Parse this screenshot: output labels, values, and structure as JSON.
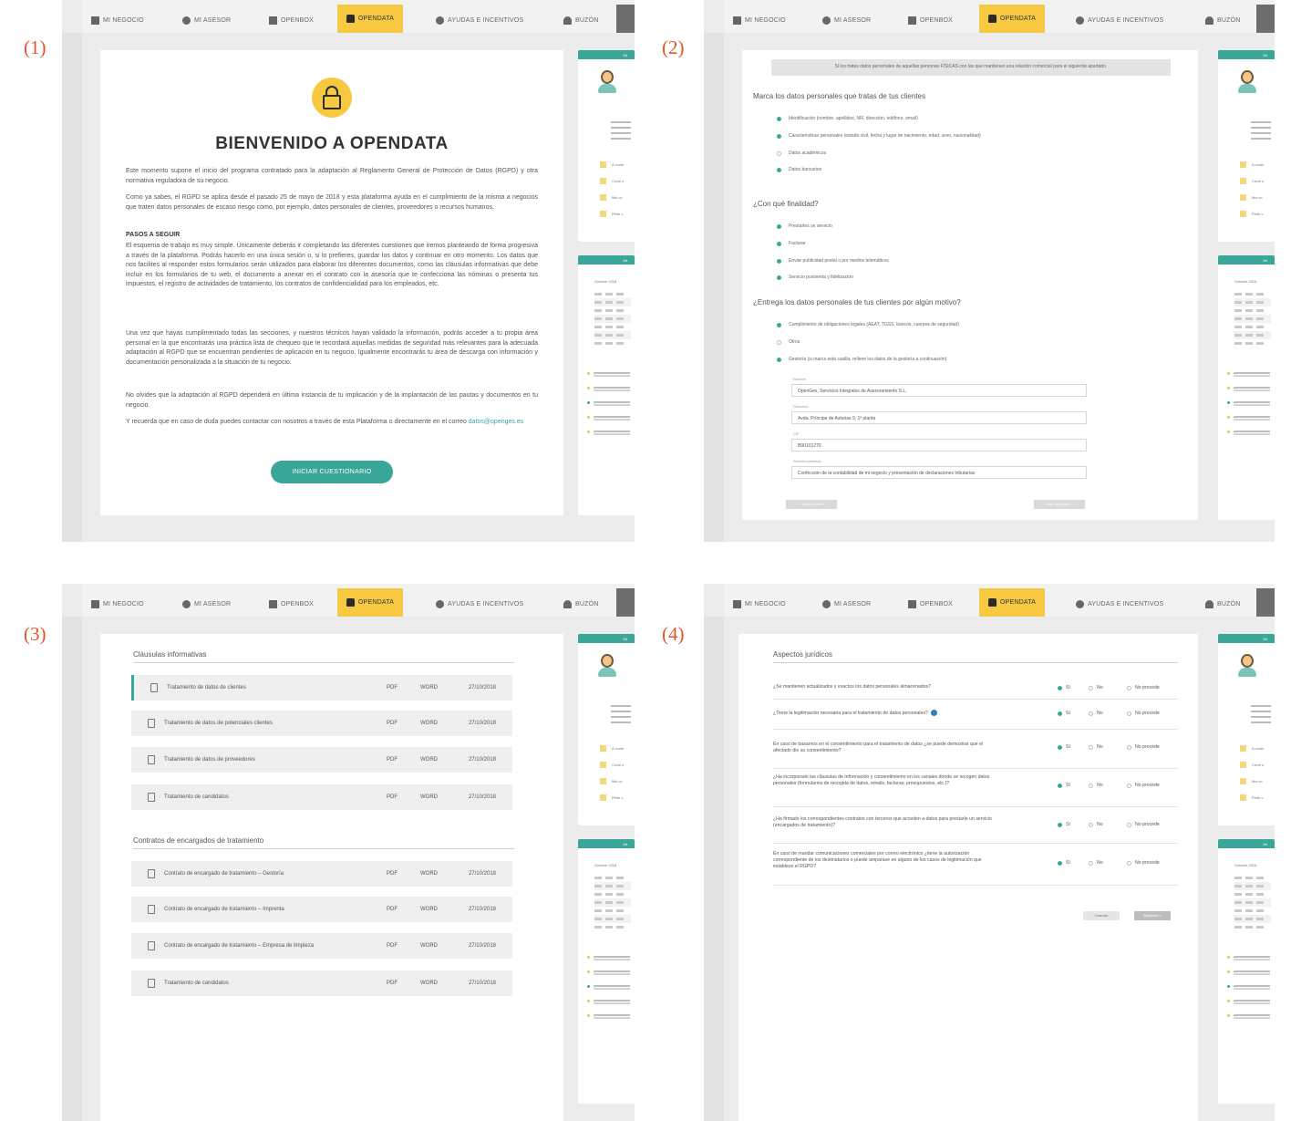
{
  "panel_labels": [
    "(1)",
    "(2)",
    "(3)",
    "(4)"
  ],
  "nav": {
    "mi_negocio": "MI NEGOCIO",
    "mi_asesor": "MI ASESOR",
    "openbox": "OPENBOX",
    "opendata": "OPENDATA",
    "ayudas": "AYUDAS E INCENTIVOS",
    "buzon": "BUZÓN"
  },
  "colors": {
    "accent": "#3aa69a",
    "highlight": "#f7c842",
    "label": "#e2552a"
  },
  "right_sidebar": {
    "card_header": "MI",
    "items": [
      "A conte",
      "Crear u",
      "Mis co",
      "Pedir c"
    ],
    "calendar_title": "Octubre 2018"
  },
  "welcome": {
    "title": "BIENVENIDO A OPENDATA",
    "p1": "Este momento supone el inicio del programa contratado para la adaptación al Reglamento General de Protección de Datos (RGPD) y otra normativa reguladora de su negocio.",
    "p2": "Como ya sabes, el RGPD se aplica desde el pasado 25 de mayo de 2018 y esta plataforma ayuda en el cumplimiento de la misma a negocios que traten datos personales de escaso riesgo como, por ejemplo, datos personales de clientes, proveedores o recursos humanos.",
    "steps_heading": "PASOS A SEGUIR",
    "p3": "El esquema de trabajo es muy simple. Únicamente deberás ir completando las diferentes cuestiones que iremos planteando de forma progresiva a través de la plataforma. Podrás hacerlo en una única sesión o, si lo prefieres, guardar los datos y continuar en otro momento. Los datos que nos facilites al responder estos formularios serán utilizados para elaborar los diferentes documentos, como las cláusulas informativas que debe incluir en los formularios de tu web, el documento a anexar en el contrato con la asesoría que te confecciona las nóminas o presenta tus impuestos, el registro de actividades de tratamiento, los contratos de confidencialidad para los empleados, etc.",
    "p4": "Una vez que hayas cumplimentado todas las secciones, y nuestros técnicos hayan validado la información, podrás acceder a tu propia área personal en la que encontrarás una práctica lista de chequeo que te recordará aquellas medidas de seguridad más relevantes para la adecuada adaptación al RGPD que se encuentran pendientes de aplicación en tu negocio. Igualmente encontrarás tu área de descarga con información y documentación personalizada a la situación de tu negocio.",
    "p5": "No olvides que la adaptación al RGPD dependerá en última instancia de tu implicación y de la implantación de las pautas y documentos en tu negocio.",
    "p6": "Y recuerda que en caso de duda puedes contactar con nosotros a través de esta Plataforma o directamente en el correo",
    "email": "datos@openges.es",
    "button": "INICIAR CUESTIONARIO"
  },
  "form": {
    "notice": "Si los tratas datos personales de aquellas personas FÍSICAS con las que mantienes una relación comercial para el siguiente apartado.",
    "q1": "Marca los datos personales que tratas de tus clientes",
    "q1_options": [
      {
        "label": "Identificación (nombre, apellidos, NIF, dirección, teléfono, email)",
        "checked": true
      },
      {
        "label": "Características personales (estado civil, fecha y lugar de nacimiento, edad, sexo, nacionalidad)",
        "checked": true
      },
      {
        "label": "Datos académicos",
        "checked": false
      },
      {
        "label": "Datos bancarios",
        "checked": true
      }
    ],
    "q2": "¿Con qué finalidad?",
    "q2_options": [
      {
        "label": "Prestarles un servicio",
        "checked": true
      },
      {
        "label": "Facturar",
        "checked": true
      },
      {
        "label": "Enviar publicidad postal o por medios telemáticos",
        "checked": true
      },
      {
        "label": "Servicio postventa y fidelización",
        "checked": true
      }
    ],
    "q3": "¿Entrega los datos personales de tus clientes por algún motivo?",
    "q3_options": [
      {
        "label": "Cumplimiento de obligaciones legales (AEAT, TGSS, bancos, cuerpos de seguridad)",
        "checked": true
      },
      {
        "label": "Otros",
        "checked": false
      },
      {
        "label": "Gestoría (si marca esta casilla, rellene los datos de la gestoría a continuación)",
        "checked": true
      }
    ],
    "fields": [
      {
        "label": "Nombre",
        "value": "OpenGes, Servicios Integrales de Asesoramiento S.L."
      },
      {
        "label": "Dirección",
        "value": "Avda. Príncipe de Asturias 9, 1ª planta"
      },
      {
        "label": "CIF",
        "value": "B90101270"
      },
      {
        "label": "Servicio prestado",
        "value": "Confección de la contabilidad de mi negocio y presentación de declaraciones tributarias"
      }
    ],
    "prev_button": "< Paso anterior",
    "next_button": "Paso siguiente >"
  },
  "docs": {
    "section1": "Cláusulas informativas",
    "rows1": [
      {
        "name": "Tratamiento de datos de clientes",
        "pdf": "PDF",
        "word": "WORD",
        "date": "27/10/2018"
      },
      {
        "name": "Tratamiento de datos de potenciales clientes",
        "pdf": "PDF",
        "word": "WORD",
        "date": "27/10/2018"
      },
      {
        "name": "Tratamiento de datos de proveedores",
        "pdf": "PDF",
        "word": "WORD",
        "date": "27/10/2018"
      },
      {
        "name": "Tratamiento de candidatos",
        "pdf": "PDF",
        "word": "WORD",
        "date": "27/10/2018"
      }
    ],
    "section2": "Contratos de encargados de tratamiento",
    "rows2": [
      {
        "name": "Contrato de encargado de tratamiento – Gestoría",
        "pdf": "PDF",
        "word": "WORD",
        "date": "27/10/2018"
      },
      {
        "name": "Contrato de encargado de tratamiento – Imprenta",
        "pdf": "PDF",
        "word": "WORD",
        "date": "27/10/2018"
      },
      {
        "name": "Contrato de encargado de tratamiento – Empresa de limpieza",
        "pdf": "PDF",
        "word": "WORD",
        "date": "27/10/2018"
      },
      {
        "name": "Tratamiento de candidatos",
        "pdf": "PDF",
        "word": "WORD",
        "date": "27/10/2018"
      }
    ]
  },
  "legal": {
    "title": "Aspectos jurídicos",
    "answers": {
      "si": "Sí",
      "no": "No",
      "np": "No procede"
    },
    "questions": [
      "¿Se mantienen actualizados y exactos los datos personales almacenados?",
      "¿Tiene la legitimación necesaria para el tratamiento de datos personales?",
      "En caso de basarnos en el consentimiento para el tratamiento de datos ¿se puede demostrar que el afectado dio su consentimiento?",
      "¿Ha incorporado las cláusulas de información y consentimiento en los canales donde se recogen datos personales (formularios de recogida de datos, emails, facturas, presupuestos, etc.)?",
      "¿Ha firmado los correspondientes contratos con terceros que acceden a datos para prestarle un servicio (encargados de tratamiento)?",
      "En caso de mandar comunicaciones comerciales por correo electrónico ¿tiene la autorización correspondiente de los destinatarios o puede amparase en alguno de los casos de legitimación que establece el RGPD?"
    ],
    "save_button": "Guardar",
    "next_button": "Siguiente >"
  }
}
